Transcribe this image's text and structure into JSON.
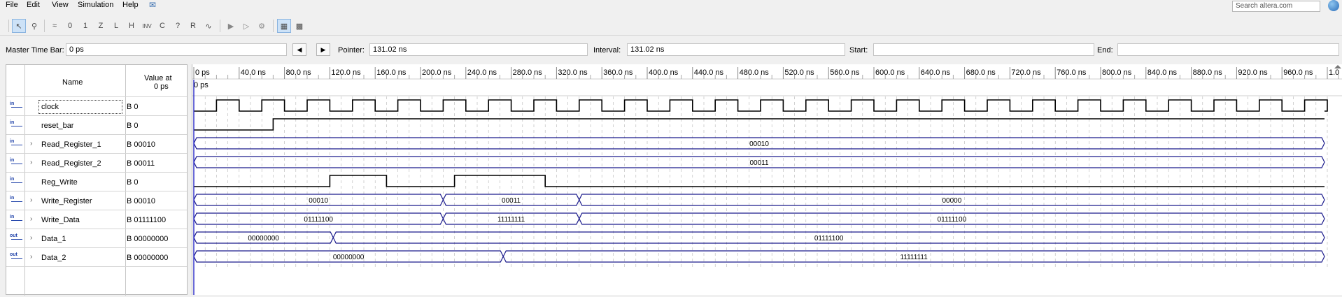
{
  "menu": [
    "File",
    "Edit",
    "View",
    "Simulation",
    "Help"
  ],
  "search": {
    "placeholder": "Search altera.com"
  },
  "toolbar_icons": [
    "selection-tool-icon",
    "zoom-tool-icon",
    "uninitialized-icon",
    "forcing-low-icon",
    "forcing-high-icon",
    "high-impedance-icon",
    "weak-low-icon",
    "weak-high-icon",
    "invert-icon",
    "count-value-icon",
    "clock-value-icon",
    "arbitrary-value-icon",
    "random-value-icon",
    "run-functional-icon",
    "run-timing-icon",
    "generate-netlist-icon",
    "snap-to-grid-icon",
    "grid-settings-icon"
  ],
  "timebar": {
    "master_label": "Master Time Bar:",
    "master_value": "0 ps",
    "pointer_label": "Pointer:",
    "pointer_value": "131.02 ns",
    "interval_label": "Interval:",
    "interval_value": "131.02 ns",
    "start_label": "Start:",
    "start_value": "",
    "end_label": "End:",
    "end_value": ""
  },
  "table_header": {
    "name": "Name",
    "value_line1": "Value at",
    "value_line2": "0 ps"
  },
  "time_ruler": {
    "cursor_label": "0 ps",
    "ticks": [
      "0 ps",
      "40.0 ns",
      "80.0 ns",
      "120.0 ns",
      "160.0 ns",
      "200.0 ns",
      "240.0 ns",
      "280.0 ns",
      "320.0 ns",
      "360.0 ns",
      "400.0 ns",
      "440.0 ns",
      "480.0 ns",
      "520.0 ns",
      "560.0 ns",
      "600.0 ns",
      "640.0 ns",
      "680.0 ns",
      "720.0 ns",
      "760.0 ns",
      "800.0 ns",
      "840.0 ns",
      "880.0 ns",
      "920.0 ns",
      "960.0 ns",
      "1.0 us"
    ]
  },
  "colors": {
    "bus": "#1a1a8c",
    "cursor": "#2a2ac8",
    "grid": "#b4b4b4"
  },
  "signals": [
    {
      "name": "clock",
      "value": "B 0",
      "icon": "in",
      "expandable": false,
      "type": "clock",
      "period_ns": 40,
      "first_rise_ns": 20
    },
    {
      "name": "reset_bar",
      "value": "B 0",
      "icon": "in",
      "expandable": false,
      "type": "bit",
      "transitions": [
        {
          "t": 0,
          "v": 0
        },
        {
          "t": 70,
          "v": 1
        }
      ]
    },
    {
      "name": "Read_Register_1",
      "value": "B 00010",
      "icon": "in-bus",
      "expandable": true,
      "type": "bus",
      "segments": [
        {
          "start": 0,
          "end": 1000,
          "label": "00010"
        }
      ]
    },
    {
      "name": "Read_Register_2",
      "value": "B 00011",
      "icon": "in-bus",
      "expandable": true,
      "type": "bus",
      "segments": [
        {
          "start": 0,
          "end": 1000,
          "label": "00011"
        }
      ]
    },
    {
      "name": "Reg_Write",
      "value": "B 0",
      "icon": "in",
      "expandable": false,
      "type": "bit",
      "transitions": [
        {
          "t": 0,
          "v": 0
        },
        {
          "t": 120,
          "v": 1
        },
        {
          "t": 170,
          "v": 0
        },
        {
          "t": 230,
          "v": 1
        },
        {
          "t": 310,
          "v": 0
        }
      ]
    },
    {
      "name": "Write_Register",
      "value": "B 00010",
      "icon": "in-bus",
      "expandable": true,
      "type": "bus",
      "segments": [
        {
          "start": 0,
          "end": 220,
          "label": "00010"
        },
        {
          "start": 220,
          "end": 340,
          "label": "00011"
        },
        {
          "start": 340,
          "end": 1000,
          "label": "00000"
        }
      ]
    },
    {
      "name": "Write_Data",
      "value": "B 01111100",
      "icon": "in-bus",
      "expandable": true,
      "type": "bus",
      "segments": [
        {
          "start": 0,
          "end": 220,
          "label": "01111100"
        },
        {
          "start": 220,
          "end": 340,
          "label": "11111111"
        },
        {
          "start": 340,
          "end": 1000,
          "label": "01111100"
        }
      ]
    },
    {
      "name": "Data_1",
      "value": "B 00000000",
      "icon": "out-bus",
      "expandable": true,
      "type": "bus",
      "segments": [
        {
          "start": 0,
          "end": 123,
          "label": "00000000"
        },
        {
          "start": 123,
          "end": 1000,
          "label": "01111100"
        }
      ]
    },
    {
      "name": "Data_2",
      "value": "B 00000000",
      "icon": "out-bus",
      "expandable": true,
      "type": "bus",
      "segments": [
        {
          "start": 0,
          "end": 273,
          "label": "00000000"
        },
        {
          "start": 273,
          "end": 1000,
          "label": "11111111"
        }
      ]
    }
  ]
}
